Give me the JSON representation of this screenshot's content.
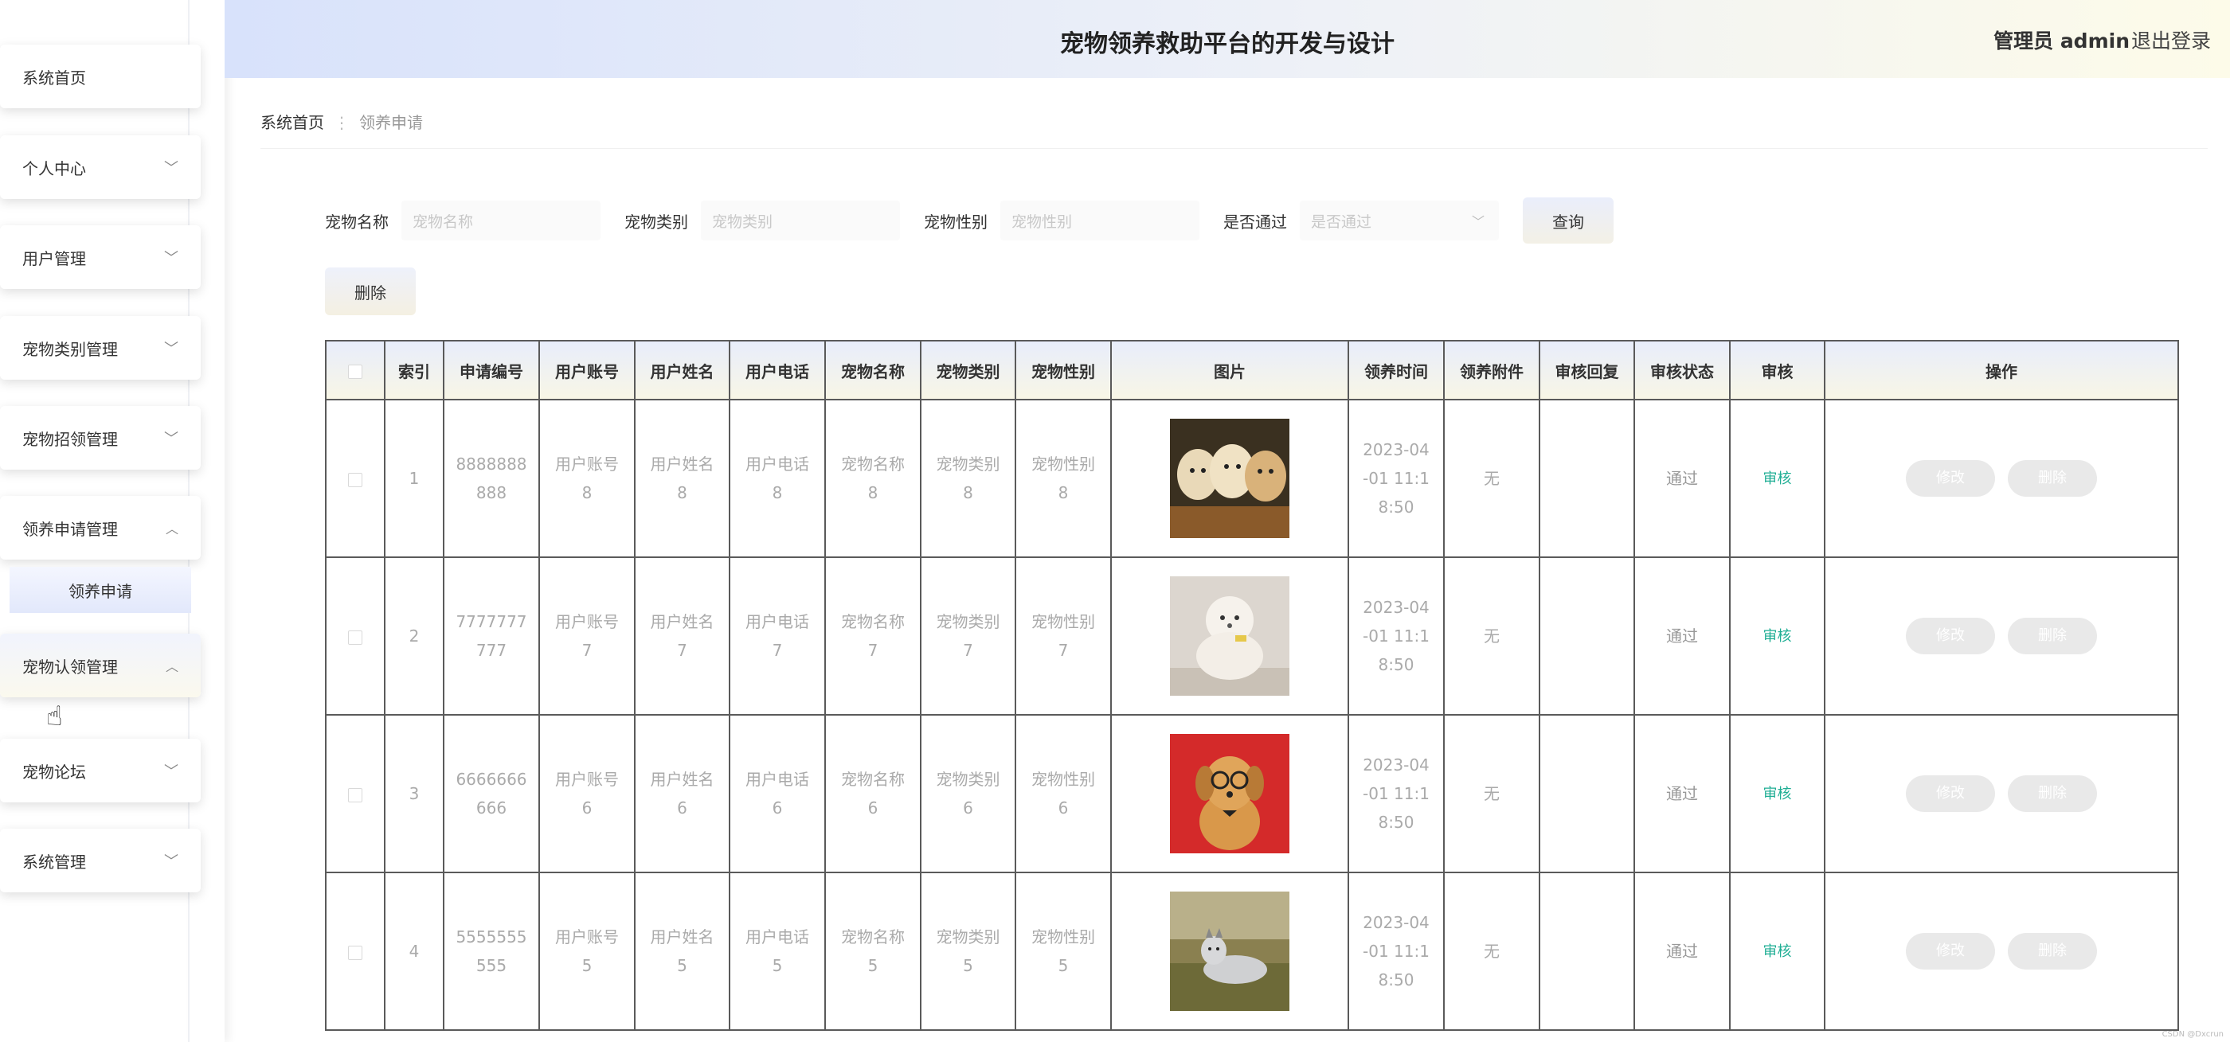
{
  "header": {
    "title": "宠物领养救助平台的开发与设计",
    "admin": "管理员 admin",
    "logout": "退出登录"
  },
  "sidebar": {
    "items": [
      {
        "label": "系统首页",
        "chevron": ""
      },
      {
        "label": "个人中心",
        "chevron": "﹀"
      },
      {
        "label": "用户管理",
        "chevron": "﹀"
      },
      {
        "label": "宠物类别管理",
        "chevron": "﹀"
      },
      {
        "label": "宠物招领管理",
        "chevron": "﹀"
      },
      {
        "label": "领养申请管理",
        "chevron": "︿"
      },
      {
        "label": "宠物认领管理",
        "chevron": "︿"
      },
      {
        "label": "宠物论坛",
        "chevron": "﹀"
      },
      {
        "label": "系统管理",
        "chevron": "﹀"
      }
    ],
    "sub_item": "领养申请"
  },
  "breadcrumb": {
    "home": "系统首页",
    "separator": "⋮",
    "current": "领养申请"
  },
  "search": {
    "fields": [
      {
        "label": "宠物名称",
        "placeholder": "宠物名称"
      },
      {
        "label": "宠物类别",
        "placeholder": "宠物类别"
      },
      {
        "label": "宠物性别",
        "placeholder": "宠物性别"
      },
      {
        "label": "是否通过",
        "placeholder": "是否通过"
      }
    ],
    "query_button": "查询"
  },
  "delete_button": "删除",
  "table": {
    "columns": [
      "",
      "索引",
      "申请编号",
      "用户账号",
      "用户姓名",
      "用户电话",
      "宠物名称",
      "宠物类别",
      "宠物性别",
      "图片",
      "领养时间",
      "领养附件",
      "审核回复",
      "审核状态",
      "审核",
      "操作"
    ],
    "rows": [
      {
        "index": "1",
        "app_no": "8888888888",
        "account": "用户账号8",
        "name": "用户姓名8",
        "phone": "用户电话8",
        "pet_name": "宠物名称8",
        "pet_type": "宠物类别8",
        "pet_gender": "宠物性别8",
        "image": "golden-retriever-puppies",
        "time": "2023-04-01 11:18:50",
        "attachment": "无",
        "reply": "",
        "status": "通过",
        "audit": "审核",
        "edit": "修改",
        "remove": "删除"
      },
      {
        "index": "2",
        "app_no": "7777777777",
        "account": "用户账号7",
        "name": "用户姓名7",
        "phone": "用户电话7",
        "pet_name": "宠物名称7",
        "pet_type": "宠物类别7",
        "pet_gender": "宠物性别7",
        "image": "white-poodle",
        "time": "2023-04-01 11:18:50",
        "attachment": "无",
        "reply": "",
        "status": "通过",
        "audit": "审核",
        "edit": "修改",
        "remove": "删除"
      },
      {
        "index": "3",
        "app_no": "6666666666",
        "account": "用户账号6",
        "name": "用户姓名6",
        "phone": "用户电话6",
        "pet_name": "宠物名称6",
        "pet_type": "宠物类别6",
        "pet_gender": "宠物性别6",
        "image": "dog-with-glasses",
        "time": "2023-04-01 11:18:50",
        "attachment": "无",
        "reply": "",
        "status": "通过",
        "audit": "审核",
        "edit": "修改",
        "remove": "删除"
      },
      {
        "index": "4",
        "app_no": "5555555555",
        "account": "用户账号5",
        "name": "用户姓名5",
        "phone": "用户电话5",
        "pet_name": "宠物名称5",
        "pet_type": "宠物类别5",
        "pet_gender": "宠物性别5",
        "image": "husky-on-grass",
        "time": "2023-04-01 11:18:50",
        "attachment": "无",
        "reply": "",
        "status": "通过",
        "audit": "审核",
        "edit": "修改",
        "remove": "删除"
      }
    ]
  },
  "watermark": "CSDN @Dxcrun",
  "colors": {
    "accent": "#1fae94",
    "header_start": "#d8e2fb",
    "header_end": "#fdfbe9"
  }
}
